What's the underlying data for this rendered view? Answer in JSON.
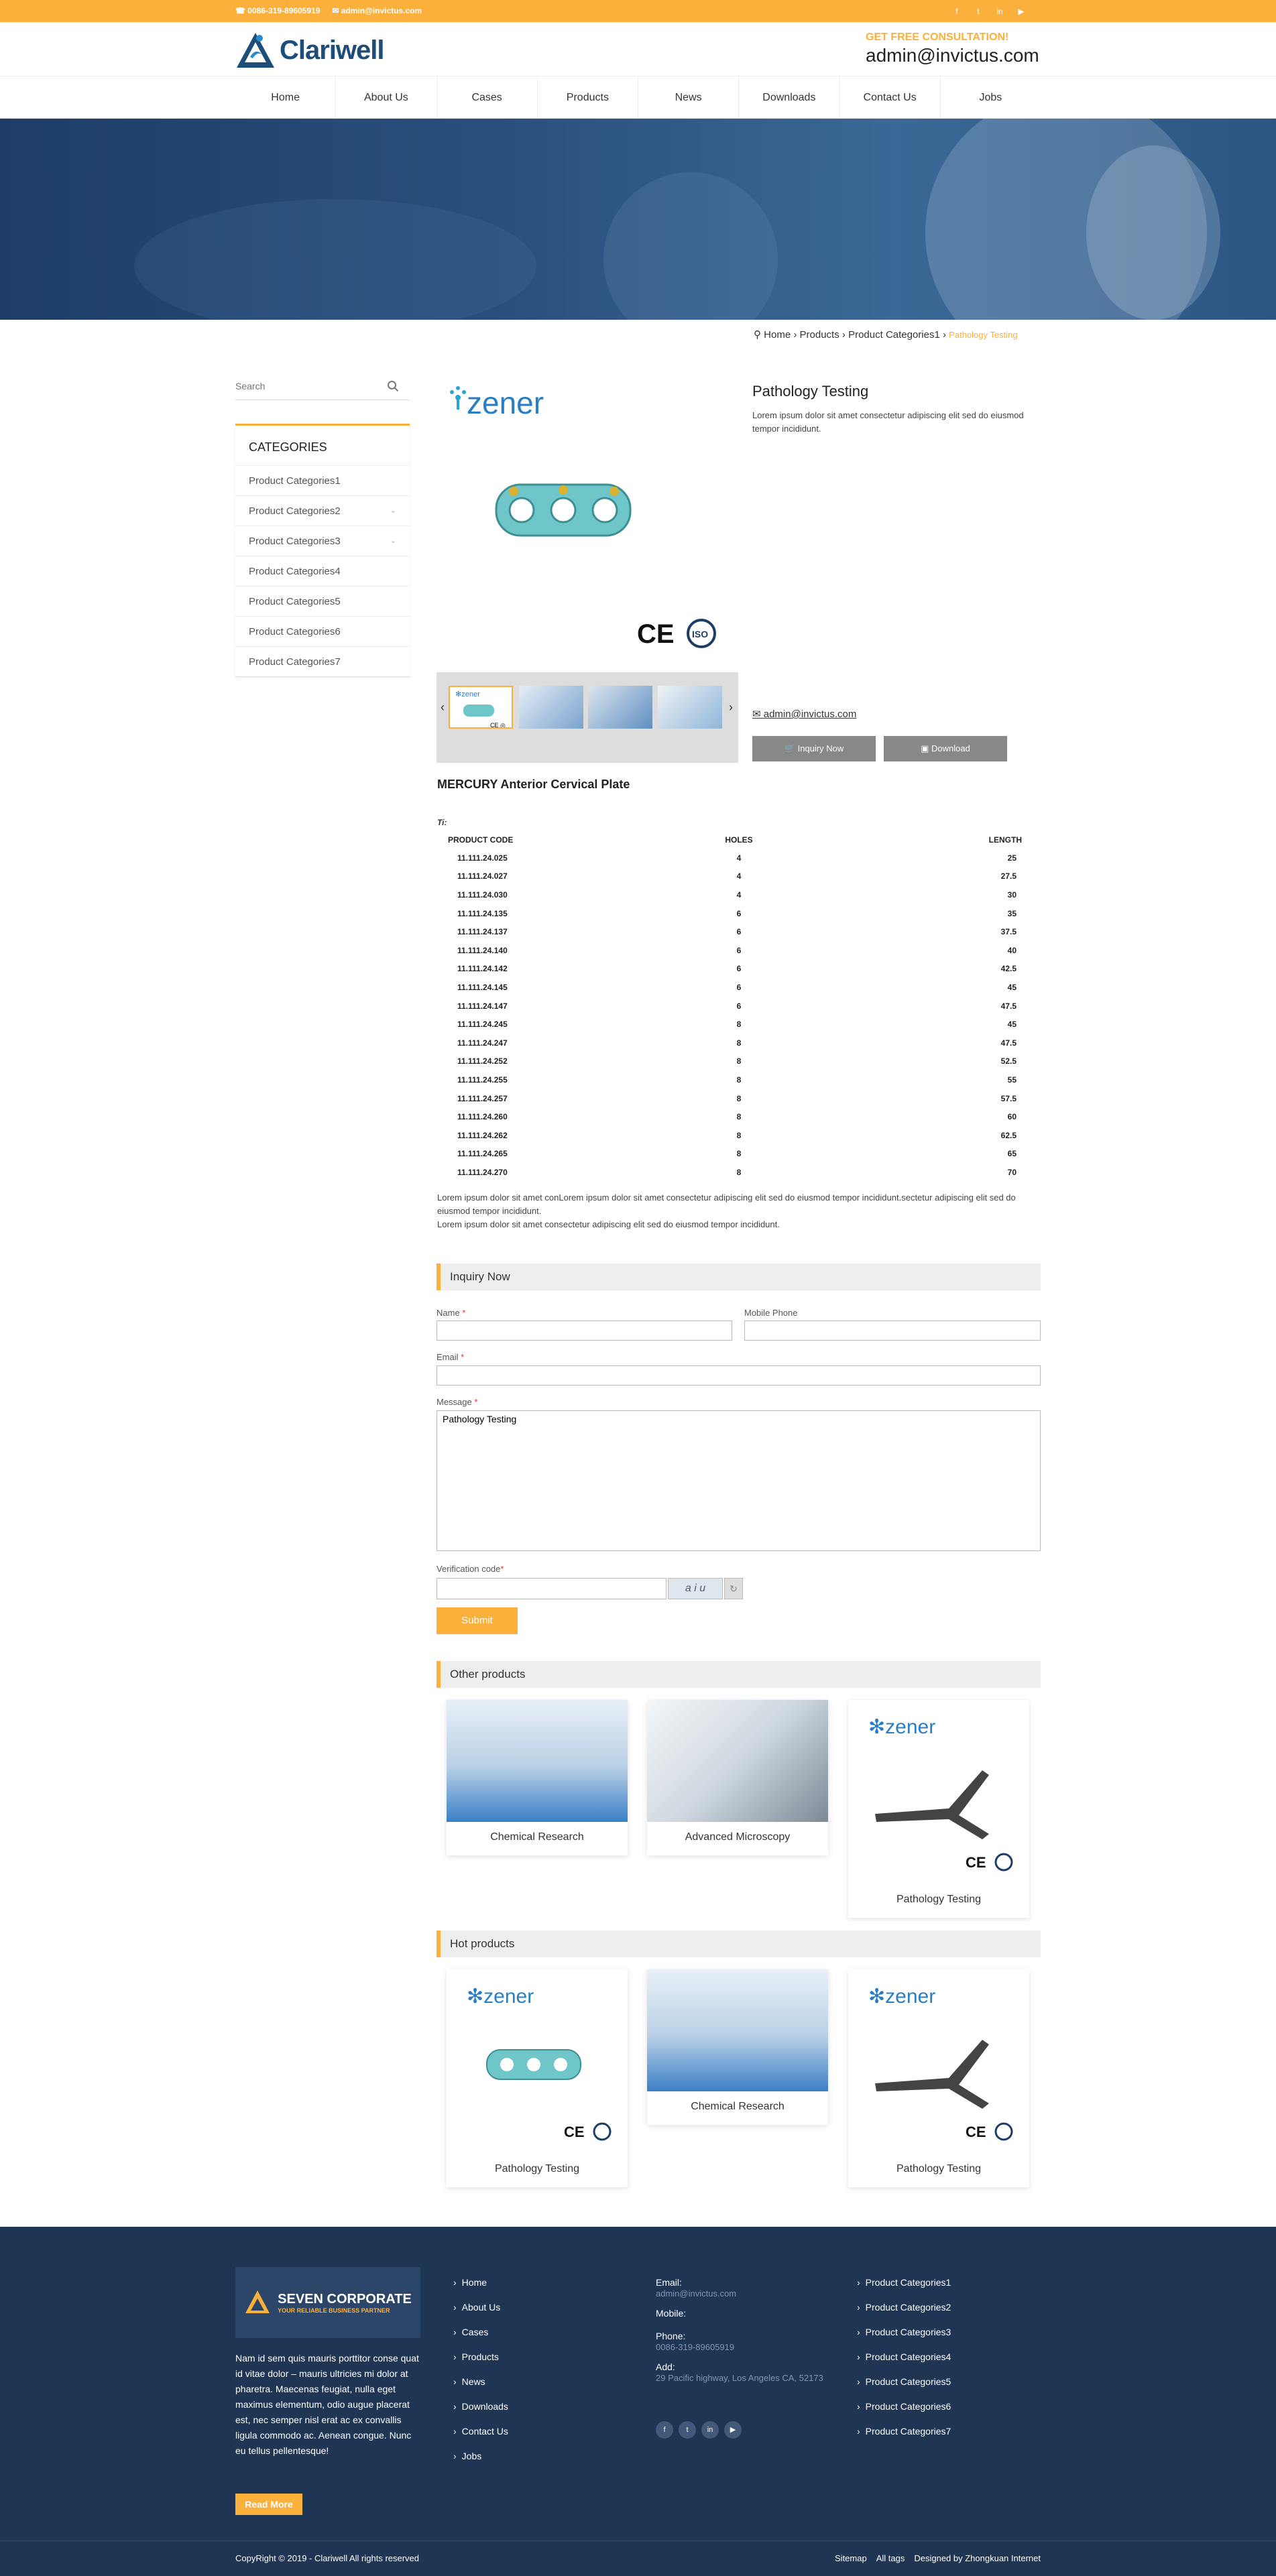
{
  "topbar": {
    "phone": "0086-319-89605919",
    "email": "admin@invictus.com",
    "social": [
      "facebook-icon",
      "twitter-icon",
      "linkedin-icon",
      "youtube-icon"
    ]
  },
  "header": {
    "logo": "Clariwell",
    "consult_label": "GET FREE CONSULTATION!",
    "consult_email": "admin@invictus.com"
  },
  "nav": [
    "Home",
    "About Us",
    "Cases",
    "Products",
    "News",
    "Downloads",
    "Contact Us",
    "Jobs"
  ],
  "breadcrumb": {
    "home": "Home",
    "products": "Products",
    "category": "Product Categories1",
    "current": "Pathology Testing"
  },
  "sidebar": {
    "search_placeholder": "Search",
    "categories_title": "CATEGORIES",
    "categories": [
      "Product Categories1",
      "Product Categories2",
      "Product Categories3",
      "Product Categories4",
      "Product Categories5",
      "Product Categories6",
      "Product Categories7"
    ]
  },
  "product": {
    "title": "Pathology Testing",
    "description": "Lorem ipsum dolor sit amet consectetur adipiscing elit sed do eiusmod tempor incididunt.",
    "email": "admin@invictus.com",
    "inquiry_btn": "Inquiry Now",
    "download_btn": "Download",
    "brand": "zener",
    "name": "MERCURY Anterior Cervical Plate",
    "ti": "Ti:",
    "spec_headers": [
      "PRODUCT CODE",
      "HOLES",
      "LENGTH"
    ],
    "spec_rows": [
      [
        "11.111.24.025",
        "4",
        "25"
      ],
      [
        "11.111.24.027",
        "4",
        "27.5"
      ],
      [
        "11.111.24.030",
        "4",
        "30"
      ],
      [
        "11.111.24.135",
        "6",
        "35"
      ],
      [
        "11.111.24.137",
        "6",
        "37.5"
      ],
      [
        "11.111.24.140",
        "6",
        "40"
      ],
      [
        "11.111.24.142",
        "6",
        "42.5"
      ],
      [
        "11.111.24.145",
        "6",
        "45"
      ],
      [
        "11.111.24.147",
        "6",
        "47.5"
      ],
      [
        "11.111.24.245",
        "8",
        "45"
      ],
      [
        "11.111.24.247",
        "8",
        "47.5"
      ],
      [
        "11.111.24.252",
        "8",
        "52.5"
      ],
      [
        "11.111.24.255",
        "8",
        "55"
      ],
      [
        "11.111.24.257",
        "8",
        "57.5"
      ],
      [
        "11.111.24.260",
        "8",
        "60"
      ],
      [
        "11.111.24.262",
        "8",
        "62.5"
      ],
      [
        "11.111.24.265",
        "8",
        "65"
      ],
      [
        "11.111.24.270",
        "8",
        "70"
      ]
    ],
    "note1": "Lorem ipsum dolor sit amet conLorem ipsum dolor sit amet consectetur adipiscing elit sed do eiusmod tempor incididunt.sectetur adipiscing elit sed do eiusmod tempor incididunt.",
    "note2": "Lorem ipsum dolor sit amet consectetur adipiscing elit sed do eiusmod tempor incididunt."
  },
  "inquiry": {
    "title": "Inquiry Now",
    "name_label": "Name",
    "phone_label": "Mobile Phone",
    "email_label": "Email",
    "message_label": "Message",
    "message_value": "Pathology Testing",
    "verify_label": "Verification code",
    "captcha": "a i u",
    "submit": "Submit"
  },
  "other_products": {
    "title": "Other products",
    "items": [
      "Chemical Research",
      "Advanced Microscopy",
      "Pathology Testing"
    ]
  },
  "hot_products": {
    "title": "Hot products",
    "items": [
      "Pathology Testing",
      "Chemical Research",
      "Pathology Testing"
    ]
  },
  "footer": {
    "logo_title": "SEVEN CORPORATE",
    "logo_sub": "YOUR RELIABLE BUSINESS PARTNER",
    "about": "Nam id sem quis mauris porttitor conse quat id vitae dolor – mauris ultricies mi dolor at pharetra. Maecenas feugiat, nulla eget maximus elementum, odio augue placerat est, nec semper nisl erat ac ex convallis ligula commodo ac. Aenean congue. Nunc eu tellus pellentesque!",
    "read_more": "Read More",
    "links": [
      "Home",
      "About Us",
      "Cases",
      "Products",
      "News",
      "Downloads",
      "Contact Us",
      "Jobs"
    ],
    "email_label": "Email:",
    "email": "admin@invictus.com",
    "mobile_label": "Mobile:",
    "phone_label": "Phone:",
    "phone": "0086-319-89605919",
    "add_label": "Add:",
    "address": "29 Pacific highway, Los Angeles CA, 52173",
    "categories": [
      "Product Categories1",
      "Product Categories2",
      "Product Categories3",
      "Product Categories4",
      "Product Categories5",
      "Product Categories6",
      "Product Categories7"
    ],
    "copyright": "CopyRight © 2019 -  Clariwell  All rights reserved",
    "bottom_links": [
      "Sitemap",
      "All tags",
      "Designed by Zhongkuan Internet"
    ]
  },
  "colors": {
    "accent": "#fbb03b",
    "navy": "#1f3554",
    "logo": "#1d4e7a"
  }
}
